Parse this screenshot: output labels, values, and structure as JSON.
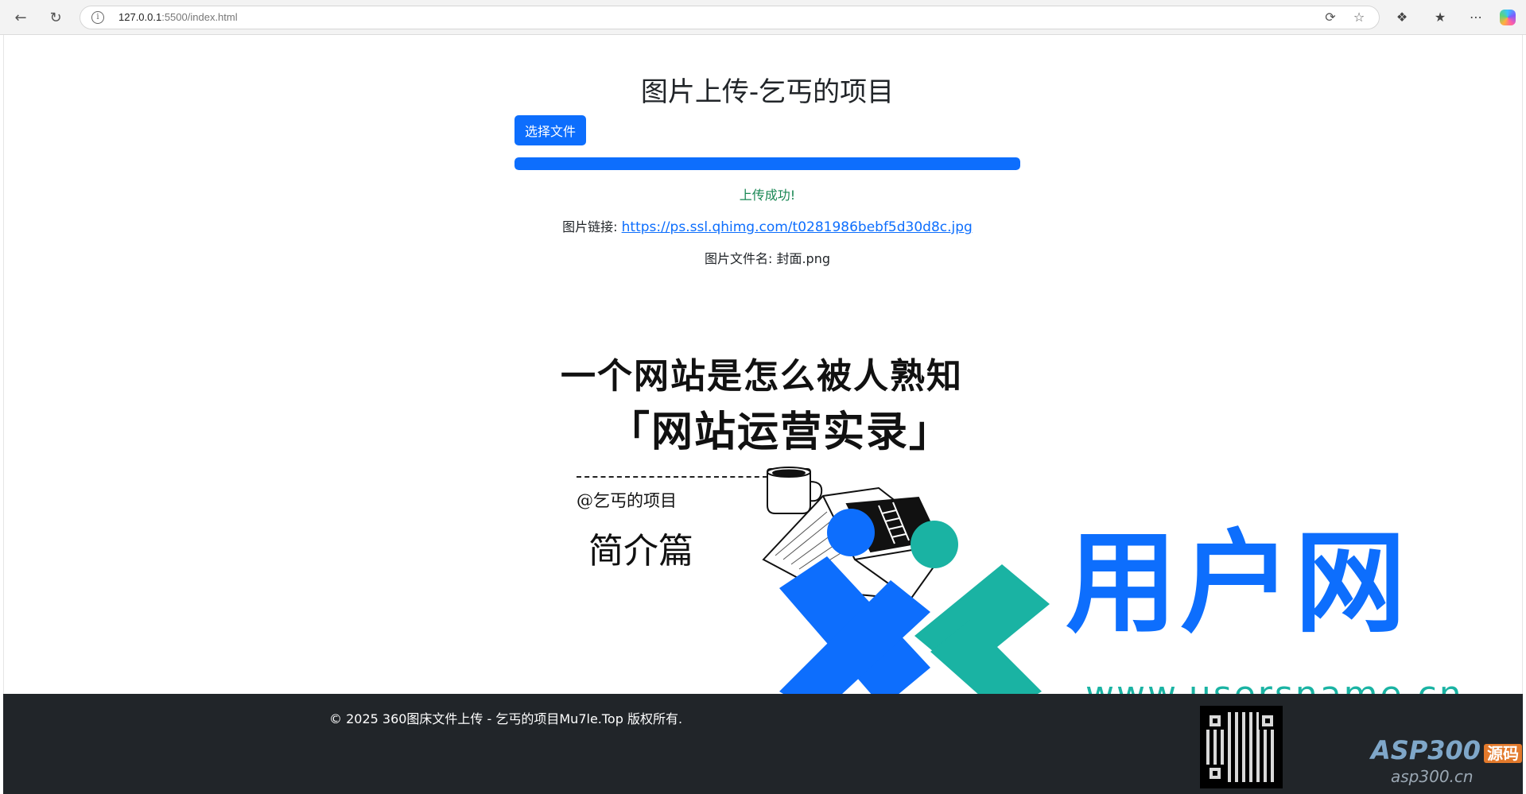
{
  "browser": {
    "url_host": "127.0.0.1",
    "url_rest": ":5500/index.html"
  },
  "page": {
    "title": "图片上传-乞丐的项目",
    "choose_button": "选择文件",
    "progress_percent": 100,
    "status": "上传成功!",
    "link_label": "图片链接: ",
    "link_url": "https://ps.ssl.qhimg.com/t0281986bebf5d30d8c.jpg",
    "filename_line": "图片文件名: 封面.png"
  },
  "cover": {
    "line1": "一个网站是怎么被人熟知",
    "line2": "「网站运营实录」",
    "author": "@乞丐的项目",
    "chapter": "简介篇"
  },
  "watermark": {
    "brand": "用户网",
    "url": "www.usersname.cn"
  },
  "footer": {
    "copyright": "© 2025 360图床文件上传 - 乞丐的项目Mu7le.Top 版权所有.",
    "asp_brand": "ASP300",
    "asp_tag": "源码",
    "asp_url": "asp300.cn"
  },
  "colors": {
    "primary": "#0d6efd",
    "success": "#198754",
    "footer_bg": "#212529",
    "watermark_teal": "#1ab3a3"
  }
}
